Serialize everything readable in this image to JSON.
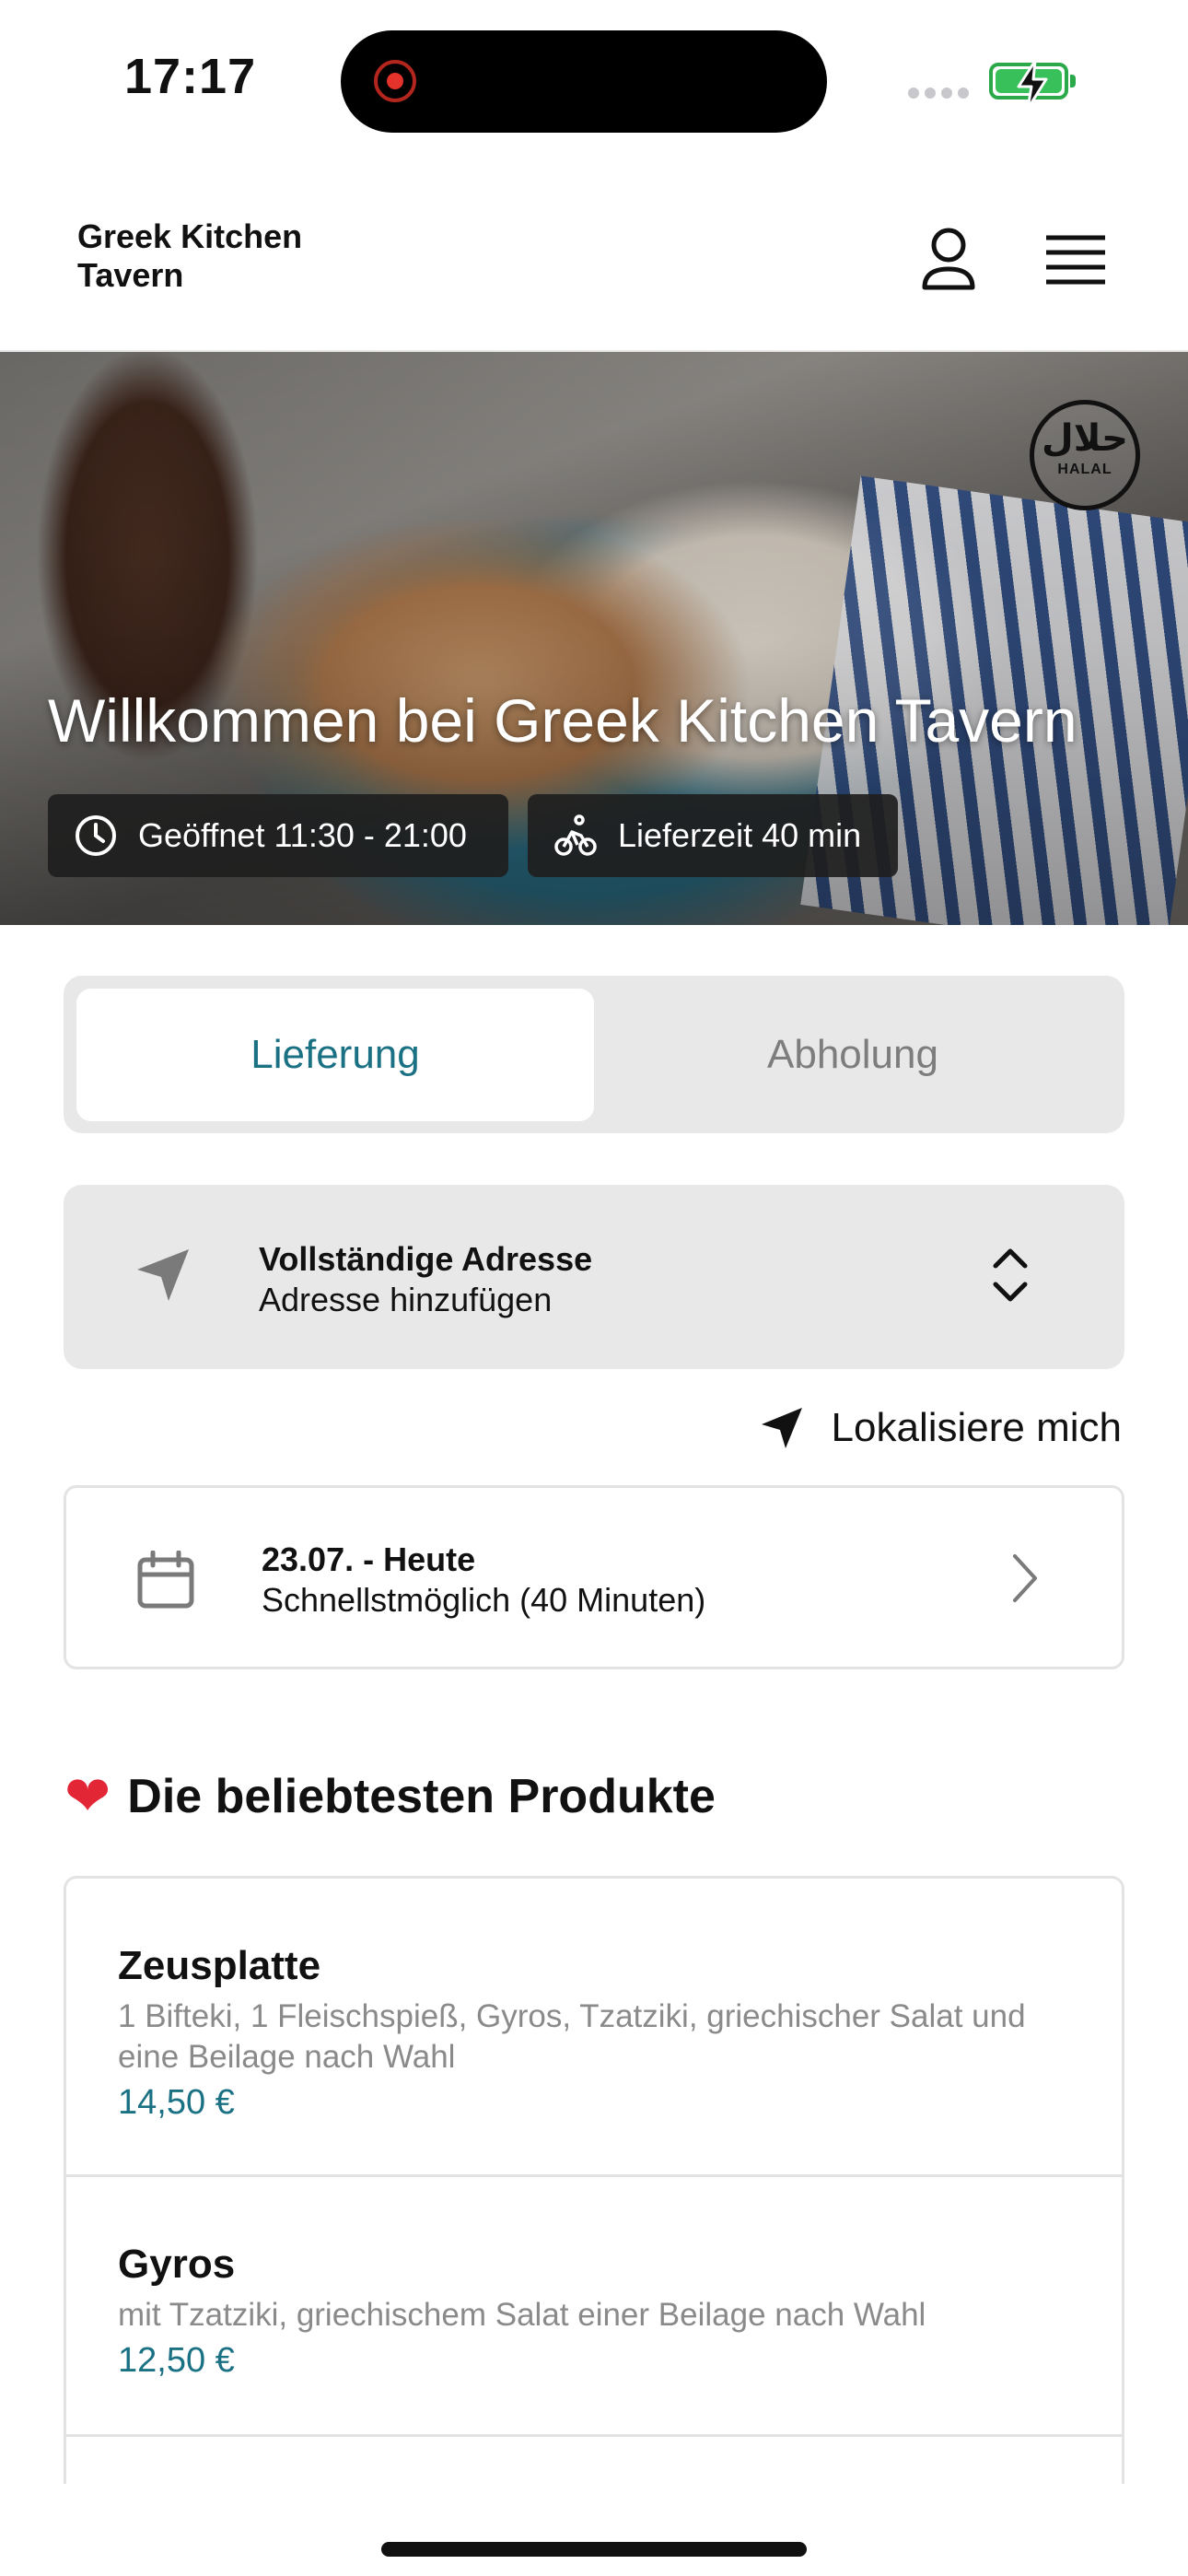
{
  "status_bar": {
    "time": "17:17"
  },
  "header": {
    "brand": "Greek Kitchen Tavern"
  },
  "hero": {
    "badge_arabic": "حلال",
    "badge_latin": "HALAL",
    "title": "Willkommen bei Greek Kitchen Tavern",
    "opening_hours": "Geöffnet 11:30 - 21:00",
    "delivery_time": "Lieferzeit 40 min"
  },
  "order_mode": {
    "delivery_label": "Lieferung",
    "pickup_label": "Abholung",
    "selected": "Lieferung"
  },
  "address": {
    "title": "Vollständige Adresse",
    "subtitle": "Adresse hinzufügen"
  },
  "locate": {
    "label": "Lokalisiere mich"
  },
  "schedule": {
    "date": "23.07. - Heute",
    "time": "Schnellstmöglich (40 Minuten)"
  },
  "popular": {
    "title": "Die beliebtesten Produkte",
    "products": [
      {
        "name": "Zeusplatte",
        "description": "1 Bifteki, 1 Fleischspieß, Gyros, Tzatziki, griechischer Salat und eine Beilage nach Wahl",
        "price": "14,50 €"
      },
      {
        "name": "Gyros",
        "description": "mit Tzatziki, griechischem Salat einer Beilage nach Wahl",
        "price": "12,50 €"
      }
    ]
  },
  "colors": {
    "accent": "#1b7184",
    "segment_bg": "#e8e8e8",
    "heart": "#e32636"
  }
}
